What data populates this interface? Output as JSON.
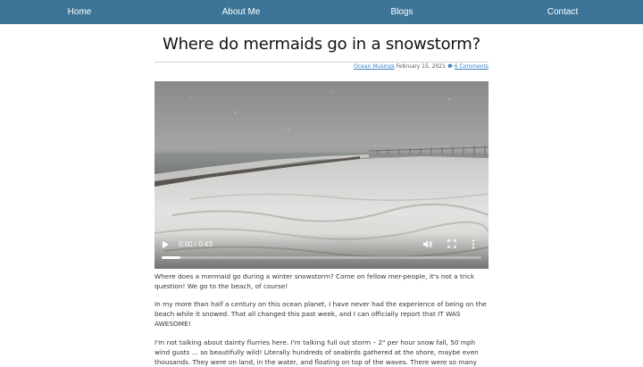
{
  "nav": {
    "items": [
      {
        "label": "Home"
      },
      {
        "label": "About Me"
      },
      {
        "label": "Blogs"
      },
      {
        "label": "Contact"
      }
    ]
  },
  "post": {
    "title": "Where do mermaids go in a snowstorm?",
    "meta": {
      "category": "Ocean Musings",
      "date": "February 15, 2021",
      "comments": "6 Comments",
      "comment_icon": "comment-icon"
    },
    "video": {
      "time": "0:00 / 0:43",
      "progress": 0.06,
      "icons": [
        "play-icon",
        "volume-icon",
        "fullscreen-icon",
        "more-icon"
      ]
    },
    "paragraphs": [
      "Where does a mermaid go during a winter snowstorm? Come on fellow mer-people, it's not a trick question! We go to the beach, of course!",
      "In my more than half a century on this ocean planet, I have never had the experience of being on the beach while it snowed. That all changed this past week, and I can officially report that IT WAS AWESOME!",
      "I'm not talking about dainty flurries here. I'm talking full out storm – 2\" per hour snow fall, 50 mph wind gusts … so beautifully wild! Literally hundreds of seabirds gathered at the shore, maybe even thousands. They were on land, in the water, and floating on top of the waves. There were so many"
    ]
  }
}
